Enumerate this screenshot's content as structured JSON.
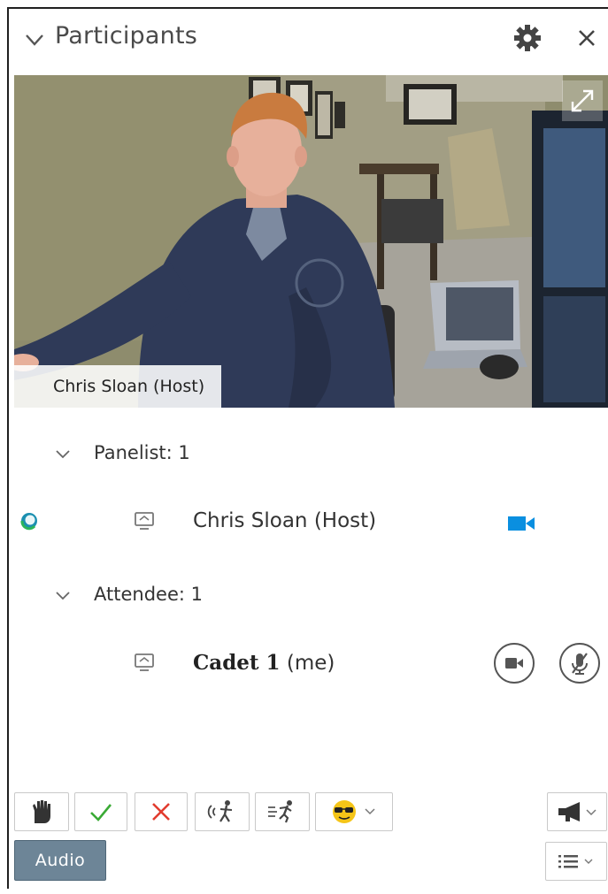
{
  "panel": {
    "title": "Participants",
    "icons": {
      "collapse": "chevron-down-icon",
      "settings": "gear-icon",
      "close": "close-icon"
    }
  },
  "video": {
    "caption": "Chris Sloan (Host)",
    "expand_icon": "expand-icon"
  },
  "groups": [
    {
      "label": "Panelist: 1",
      "participants": [
        {
          "name": "Chris Sloan (Host)",
          "status_icon": "status-ring-icon",
          "share_icon": "screen-share-icon",
          "video_icon": "video-camera-icon",
          "video_color": "#0a8fe0"
        }
      ]
    },
    {
      "label": "Attendee: 1",
      "participants": [
        {
          "name": "Cadet 1",
          "suffix": "(me)",
          "share_icon": "screen-share-icon",
          "video_button": "video-camera-icon",
          "mute_button": "microphone-muted-icon"
        }
      ]
    }
  ],
  "toolbar": {
    "buttons": [
      "raise-hand-icon",
      "checkmark-icon",
      "x-mark-icon",
      "speaker-waving-icon",
      "running-figure-icon",
      "emoji-sunglasses-icon"
    ],
    "right_buttons": [
      "megaphone-icon",
      "list-icon"
    ],
    "audio_label": "Audio",
    "colors": {
      "check": "#3aaa35",
      "x": "#e23b2e",
      "emoji": "#f5c518"
    }
  }
}
